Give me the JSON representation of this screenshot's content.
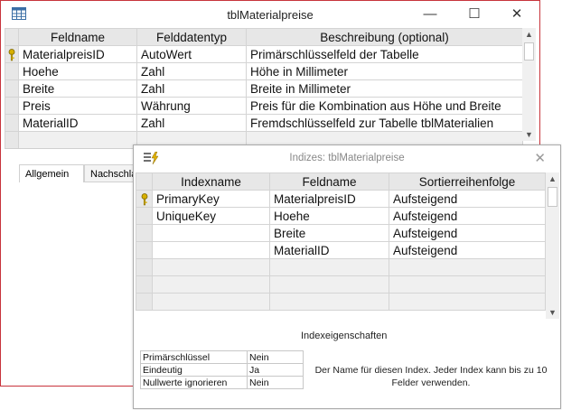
{
  "window": {
    "title": "tblMaterialpreise"
  },
  "design_grid": {
    "headers": [
      "Feldname",
      "Felddatentyp",
      "Beschreibung (optional)"
    ],
    "rows": [
      {
        "name": "MaterialpreisID",
        "type": "AutoWert",
        "desc": "Primärschlüsselfeld der Tabelle",
        "key": true
      },
      {
        "name": "Hoehe",
        "type": "Zahl",
        "desc": "Höhe in Millimeter",
        "key": false
      },
      {
        "name": "Breite",
        "type": "Zahl",
        "desc": "Breite in Millimeter",
        "key": false
      },
      {
        "name": "Preis",
        "type": "Währung",
        "desc": "Preis für die Kombination aus Höhe und Breite",
        "key": false
      },
      {
        "name": "MaterialID",
        "type": "Zahl",
        "desc": "Fremdschlüsselfeld zur Tabelle tblMaterialien",
        "key": false
      }
    ]
  },
  "tabs": {
    "general": "Allgemein",
    "lookup": "Nachschla"
  },
  "index_dialog": {
    "title": "Indizes: tblMaterialpreise",
    "headers": [
      "Indexname",
      "Feldname",
      "Sortierreihenfolge"
    ],
    "rows": [
      {
        "index": "PrimaryKey",
        "field": "MaterialpreisID",
        "order": "Aufsteigend",
        "key": true
      },
      {
        "index": "UniqueKey",
        "field": "Hoehe",
        "order": "Aufsteigend",
        "key": false
      },
      {
        "index": "",
        "field": "Breite",
        "order": "Aufsteigend",
        "key": false
      },
      {
        "index": "",
        "field": "MaterialID",
        "order": "Aufsteigend",
        "key": false
      }
    ],
    "properties_title": "Indexeigenschaften",
    "properties": [
      {
        "label": "Primärschlüssel",
        "value": "Nein"
      },
      {
        "label": "Eindeutig",
        "value": "Ja"
      },
      {
        "label": "Nullwerte ignorieren",
        "value": "Nein"
      }
    ],
    "help_text": "Der Name für diesen Index. Jeder Index kann bis zu 10 Felder verwenden."
  },
  "colors": {
    "window_border": "#c8343c",
    "header_bg": "#e7e7e7",
    "key_icon": "#d8b000"
  },
  "icons": [
    "table-icon",
    "minimize-icon",
    "maximize-icon",
    "close-icon",
    "primary-key-icon",
    "index-lightning-icon"
  ]
}
